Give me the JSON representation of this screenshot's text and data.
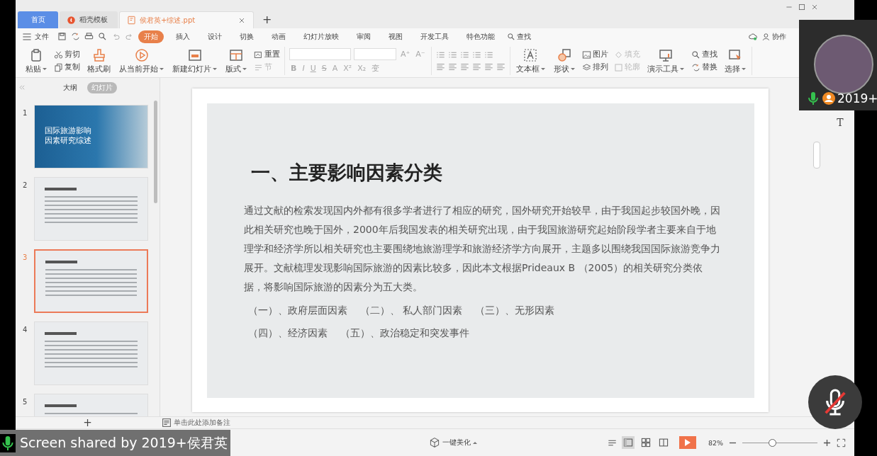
{
  "tabs": [
    {
      "kind": "home",
      "label": "首页",
      "selected": false
    },
    {
      "kind": "template",
      "label": "稻壳模板",
      "selected": false
    },
    {
      "kind": "document",
      "label": "侯君英+综述.ppt",
      "selected": true
    }
  ],
  "new_tab": "+",
  "menu": {
    "file": "文件",
    "items": [
      {
        "label": "开始",
        "selected": true
      },
      {
        "label": "插入",
        "selected": false
      },
      {
        "label": "设计",
        "selected": false
      },
      {
        "label": "切换",
        "selected": false
      },
      {
        "label": "动画",
        "selected": false
      },
      {
        "label": "幻灯片放映",
        "selected": false
      },
      {
        "label": "审阅",
        "selected": false
      },
      {
        "label": "视图",
        "selected": false
      },
      {
        "label": "开发工具",
        "selected": false
      },
      {
        "label": "特色功能",
        "selected": false
      }
    ],
    "search": "查找",
    "collab": "协作"
  },
  "ribbon": {
    "left": [
      {
        "kind": "large",
        "label": "粘贴",
        "dropdown": true
      },
      {
        "kind": "stack",
        "items": [
          {
            "label": "剪切"
          },
          {
            "label": "复制"
          }
        ]
      },
      {
        "kind": "large",
        "label": "格式刷"
      },
      {
        "kind": "large",
        "label": "从当前开始",
        "dropdown": true
      },
      {
        "kind": "large",
        "label": "新建幻灯片",
        "dropdown": true
      },
      {
        "kind": "large",
        "label": "版式",
        "dropdown": true
      },
      {
        "kind": "stack",
        "items": [
          {
            "label": "重置"
          },
          {
            "label": "节",
            "disabled": true
          }
        ]
      }
    ],
    "format_buttons": [
      "B",
      "I",
      "U",
      "S",
      "A",
      "X²",
      "X₂",
      "变"
    ],
    "size_buttons": [
      "A⁺",
      "A⁻"
    ],
    "right": [
      {
        "kind": "large",
        "label": "文本框",
        "dropdown": true
      },
      {
        "kind": "large",
        "label": "形状",
        "dropdown": true
      },
      {
        "kind": "stack",
        "items": [
          {
            "label": "图片"
          },
          {
            "label": "排列"
          }
        ]
      },
      {
        "kind": "stack",
        "items": [
          {
            "label": "填充",
            "disabled": true
          },
          {
            "label": "轮廓",
            "disabled": true
          }
        ]
      },
      {
        "kind": "large",
        "label": "演示工具",
        "dropdown": true
      },
      {
        "kind": "stack",
        "items": [
          {
            "label": "查找"
          },
          {
            "label": "替换"
          }
        ]
      },
      {
        "kind": "large",
        "label": "选择",
        "dropdown": true
      }
    ]
  },
  "panel": {
    "views": [
      {
        "label": "大纲",
        "selected": false
      },
      {
        "label": "幻灯片",
        "selected": true
      }
    ],
    "slides": [
      {
        "number": "1",
        "kind": "cover",
        "title_lines": [
          "国际旅游影响",
          "因素研究综述"
        ],
        "selected": false
      },
      {
        "number": "2",
        "kind": "text",
        "selected": false
      },
      {
        "number": "3",
        "kind": "text",
        "selected": true
      },
      {
        "number": "4",
        "kind": "text",
        "selected": false
      },
      {
        "number": "5",
        "kind": "text",
        "selected": false
      }
    ],
    "add": "+"
  },
  "slide": {
    "title": "一、主要影响因素分类",
    "paragraph": "通过文献的检索发现国内外都有很多学者进行了相应的研究，国外研究开始较早，由于我国起步较国外晚，因此相关研究也晚于国外，2000年后我国发表的相关研究出现，由于我国旅游研究起始阶段学者主要来自于地理学和经济学所以相关研究也主要围绕地旅游理学和旅游经济学方向展开，主题多以围绕我国国际旅游竞争力展开。文献梳理发现影响国际旅游的因素比较多，因此本文根据Prideaux B （2005）的相关研究分类依据，将影响国际旅游的因素分为五大类。",
    "factor_rows": [
      [
        "（一）、政府层面因素",
        "（二）、 私人部门因素",
        "（三）、无形因素"
      ],
      [
        "（四）、经济因素",
        "（五）、政治稳定和突发事件"
      ]
    ]
  },
  "side_tool": "T",
  "notes": "单击此处添加备注",
  "status_bar": {
    "beautify": "一键美化",
    "views": [
      {
        "kind": "normal",
        "selected": true
      },
      {
        "kind": "sorter",
        "selected": false
      },
      {
        "kind": "reading",
        "selected": false
      }
    ],
    "zoom": "82%",
    "zoom_slider": {
      "level": 0.4
    }
  },
  "video_tile": {
    "name": "2019+"
  },
  "share_banner": "Screen shared by 2019+侯君英"
}
